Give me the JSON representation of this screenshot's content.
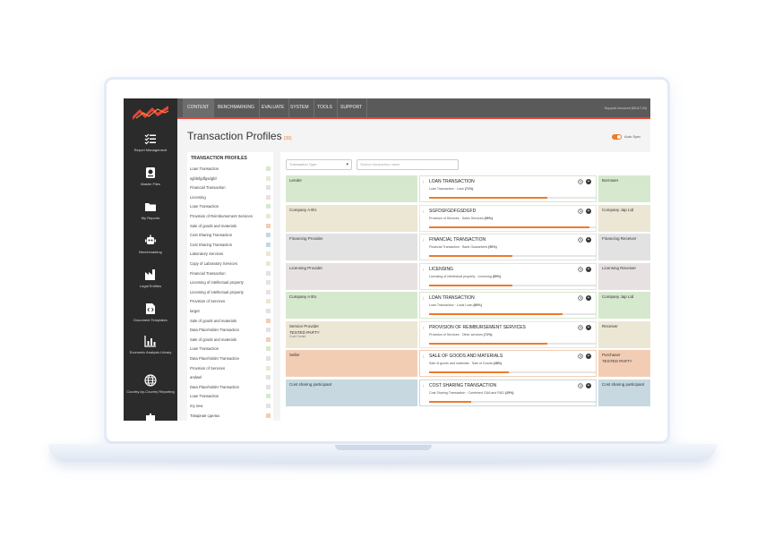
{
  "colors": {
    "green": "#d6e8cd",
    "beige": "#ece6d4",
    "grey": "#e2e2e2",
    "mauve": "#e8e1e1",
    "peach": "#f2cdb4",
    "blue": "#c7d8e1",
    "accent": "#f07a2a",
    "red": "#e8433a"
  },
  "sidebar": [
    {
      "label": "Report Management",
      "icon": "list-check-icon"
    },
    {
      "label": "Master Files",
      "icon": "file-badge-icon"
    },
    {
      "label": "My Reports",
      "icon": "folder-icon"
    },
    {
      "label": "Benchmarking",
      "icon": "robot-icon"
    },
    {
      "label": "Legal Entities",
      "icon": "factory-icon"
    },
    {
      "label": "Document Templates",
      "icon": "code-file-icon"
    },
    {
      "label": "Economic Analysis Library",
      "icon": "bar-chart-icon"
    },
    {
      "label": "Country-by-Country Reporting",
      "icon": "globe-icon"
    }
  ],
  "nav": {
    "tabs": [
      "CONTENT",
      "BENCHMARKING",
      "EVALUATE",
      "SYSTEM",
      "TOOLS",
      "SUPPORT"
    ],
    "account": "Support Account (BULT-M)"
  },
  "page": {
    "title": "Transaction Profiles",
    "count": "(39)",
    "autosync": "Auto Sync"
  },
  "tp_list": {
    "header": "TRANSACTION PROFILES",
    "items": [
      {
        "label": "Loan Transaction",
        "color": "green"
      },
      {
        "label": "sgfdsfgdfgsdgfd",
        "color": "beige"
      },
      {
        "label": "Financial Transaction",
        "color": "grey"
      },
      {
        "label": "Licensing",
        "color": "mauve"
      },
      {
        "label": "Loan Transaction",
        "color": "green"
      },
      {
        "label": "Provision of Reimbursement Services",
        "color": "beige"
      },
      {
        "label": "Sale of goods and materials",
        "color": "peach"
      },
      {
        "label": "Cost Sharing Transaction",
        "color": "blue"
      },
      {
        "label": "Cost Sharing Transaction",
        "color": "blue"
      },
      {
        "label": "Laboratory Services",
        "color": "beige"
      },
      {
        "label": "Copy of Laboratory Services",
        "color": "beige"
      },
      {
        "label": "Financial Transaction",
        "color": "grey"
      },
      {
        "label": "Licensing of intellectual property",
        "color": "mauve"
      },
      {
        "label": "Licensing of intellectual property",
        "color": "mauve"
      },
      {
        "label": "Provision of Services",
        "color": "beige"
      },
      {
        "label": "target",
        "color": "grey"
      },
      {
        "label": "Sale of goods and materials",
        "color": "peach"
      },
      {
        "label": "Data Placeholder Transaction",
        "color": "grey"
      },
      {
        "label": "Sale of goods and materials",
        "color": "peach"
      },
      {
        "label": "Loan Transaction",
        "color": "green"
      },
      {
        "label": "Data Placeholder Transaction",
        "color": "grey"
      },
      {
        "label": "Provision of Services",
        "color": "beige"
      },
      {
        "label": "andwel",
        "color": "grey"
      },
      {
        "label": "Data Placeholder Transaction",
        "color": "grey"
      },
      {
        "label": "Loan Transaction",
        "color": "green"
      },
      {
        "label": "my new",
        "color": "grey"
      },
      {
        "label": "Товарная сделка",
        "color": "peach"
      }
    ]
  },
  "filters": {
    "type_placeholder": "Transaction Type",
    "search_placeholder": "Search transaction name"
  },
  "transactions": [
    {
      "left": "Lender",
      "left_sub": "",
      "left_sub2": "",
      "title": "LOAN TRANSACTION",
      "sub": "Loan Transaction · Loan",
      "pct_text": "(71%)",
      "pct": 0.71,
      "right": "Borrower",
      "right_sub": "",
      "color": "green"
    },
    {
      "left": "Company A BV.",
      "left_sub": "",
      "left_sub2": "",
      "title": "SGFDSFGDFGSDGFD",
      "sub": "Provision of Services · Sales Services",
      "pct_text": "(96%)",
      "pct": 0.96,
      "right": "Company Jap Ltd",
      "right_sub": "",
      "color": "beige"
    },
    {
      "left": "Financing Provider",
      "left_sub": "",
      "left_sub2": "",
      "title": "FINANCIAL TRANSACTION",
      "sub": "Financial Transaction · Bank Guarantees",
      "pct_text": "(50%)",
      "pct": 0.5,
      "right": "Financing Receiver",
      "right_sub": "",
      "color": "grey"
    },
    {
      "left": "Licensing Provider",
      "left_sub": "",
      "left_sub2": "",
      "title": "LICENSING",
      "sub": "Licensing of intellectual property · Licensing",
      "pct_text": "(50%)",
      "pct": 0.5,
      "right": "Licensing Receiver",
      "right_sub": "",
      "color": "mauve"
    },
    {
      "left": "Company A BV.",
      "left_sub": "",
      "left_sub2": "",
      "title": "LOAN TRANSACTION",
      "sub": "Loan Transaction · Local Loan",
      "pct_text": "(80%)",
      "pct": 0.8,
      "right": "Company Jap Ltd",
      "right_sub": "",
      "color": "green"
    },
    {
      "left": "Service Provider",
      "left_sub": "TESTED PARTY",
      "left_sub2": "Cost Center",
      "title": "PROVISION OF REIMBURSEMENT SERVICES",
      "sub": "Provision of Services · Other services",
      "pct_text": "(71%)",
      "pct": 0.71,
      "right": "Receiver",
      "right_sub": "",
      "color": "beige"
    },
    {
      "left": "Seller",
      "left_sub": "",
      "left_sub2": "",
      "title": "SALE OF GOODS AND MATERIALS",
      "sub": "Sale of goods and materials · Sale of Goods",
      "pct_text": "(48%)",
      "pct": 0.48,
      "right": "Purchaser",
      "right_sub": "TESTED PARTY",
      "color": "peach"
    },
    {
      "left": "Cost sharing participant",
      "left_sub": "",
      "left_sub2": "",
      "title": "COST SHARING TRANSACTION",
      "sub": "Cost Sharing Transaction · Combined G&A and R&D",
      "pct_text": "(25%)",
      "pct": 0.25,
      "right": "Cost sharing participant",
      "right_sub": "",
      "color": "blue"
    }
  ]
}
